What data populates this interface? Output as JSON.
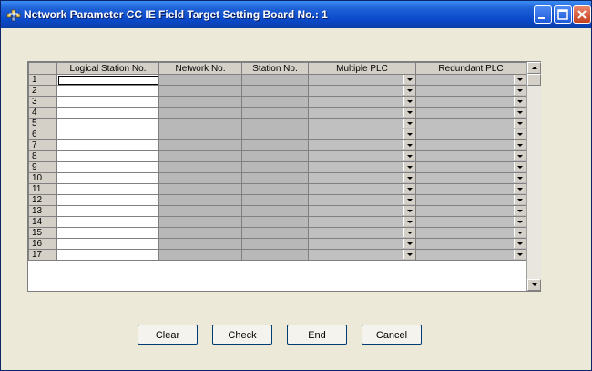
{
  "window": {
    "title": "Network Parameter CC IE Field Target Setting Board No.: 1"
  },
  "grid": {
    "columns": [
      "",
      "Logical Station No.",
      "Network No.",
      "Station No.",
      "Multiple PLC",
      "Redundant PLC"
    ],
    "rows": [
      "1",
      "2",
      "3",
      "4",
      "5",
      "6",
      "7",
      "8",
      "9",
      "10",
      "11",
      "12",
      "13",
      "14",
      "15",
      "16",
      "17"
    ]
  },
  "buttons": {
    "clear": "Clear",
    "check": "Check",
    "end": "End",
    "cancel": "Cancel"
  }
}
